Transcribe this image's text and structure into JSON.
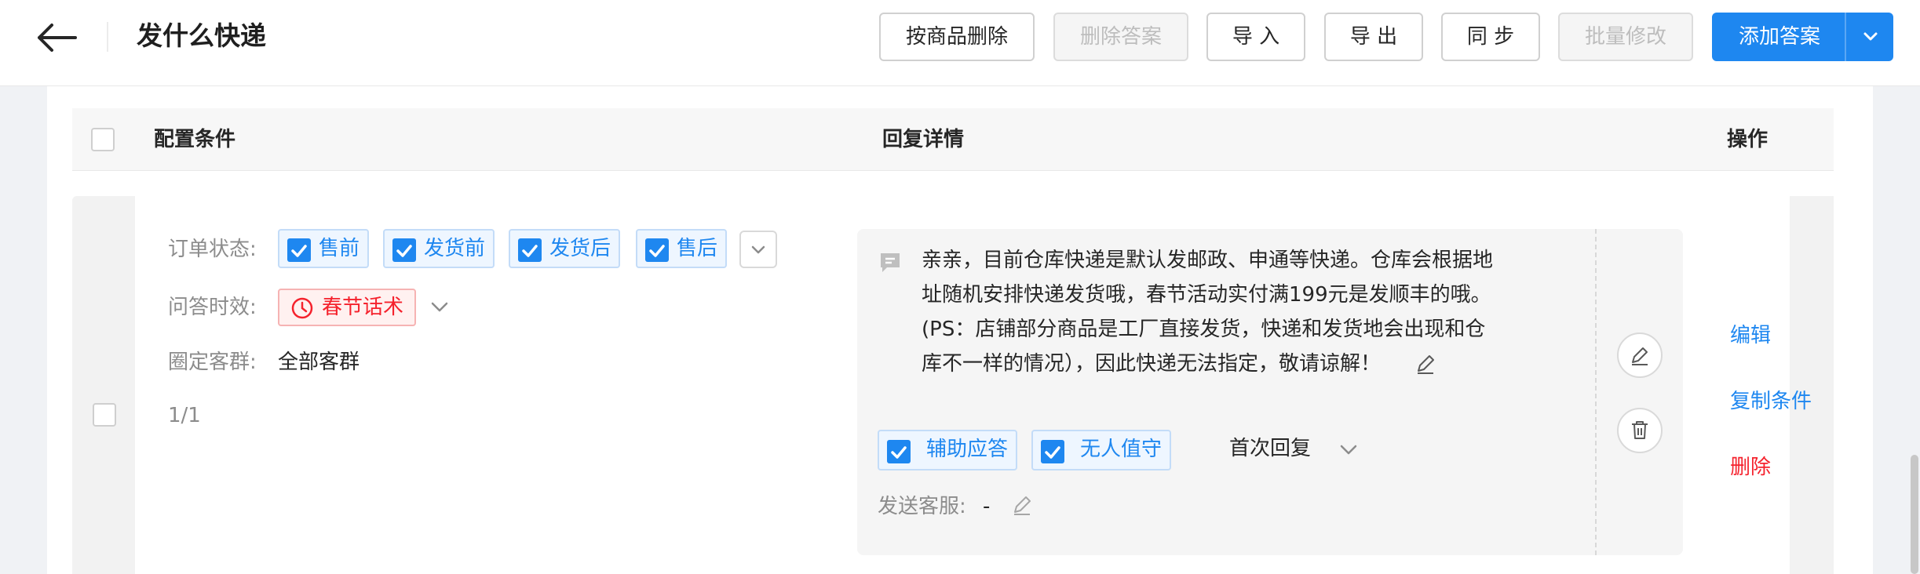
{
  "header": {
    "title": "发什么快递",
    "buttons": {
      "delete_by_product": "按商品删除",
      "delete_answer": "删除答案",
      "import": "导 入",
      "export": "导 出",
      "sync": "同 步",
      "batch_edit": "批量修改",
      "add_answer": "添加答案"
    }
  },
  "table": {
    "columns": {
      "config": "配置条件",
      "reply": "回复详情",
      "action": "操作"
    }
  },
  "row": {
    "order_status_label": "订单状态:",
    "order_status_tags": [
      "售前",
      "发货前",
      "发货后",
      "售后"
    ],
    "qa_time_label": "问答时效:",
    "qa_time_value": "春节话术",
    "audience_label": "圈定客群:",
    "audience_value": "全部客群",
    "pagination": "1/1",
    "reply_lines": [
      "亲亲，目前仓库快递是默认发邮政、申通等快递。仓库会根据地",
      "址随机安排快递发货哦，春节活动实付满199元是发顺丰的哦。",
      "(PS：店铺部分商品是工厂直接发货，快递和发货地会出现和仓",
      "库不一样的情况），因此快递无法指定，敬请谅解！"
    ],
    "reply_options": [
      "辅助应答",
      "无人值守"
    ],
    "reply_mode": "首次回复",
    "send_service_label": "发送客服:",
    "send_service_value": "-",
    "actions": {
      "edit": "编辑",
      "copy": "复制条件",
      "delete": "删除"
    }
  },
  "colors": {
    "primary": "#1e87f0",
    "danger": "#f5222d"
  }
}
